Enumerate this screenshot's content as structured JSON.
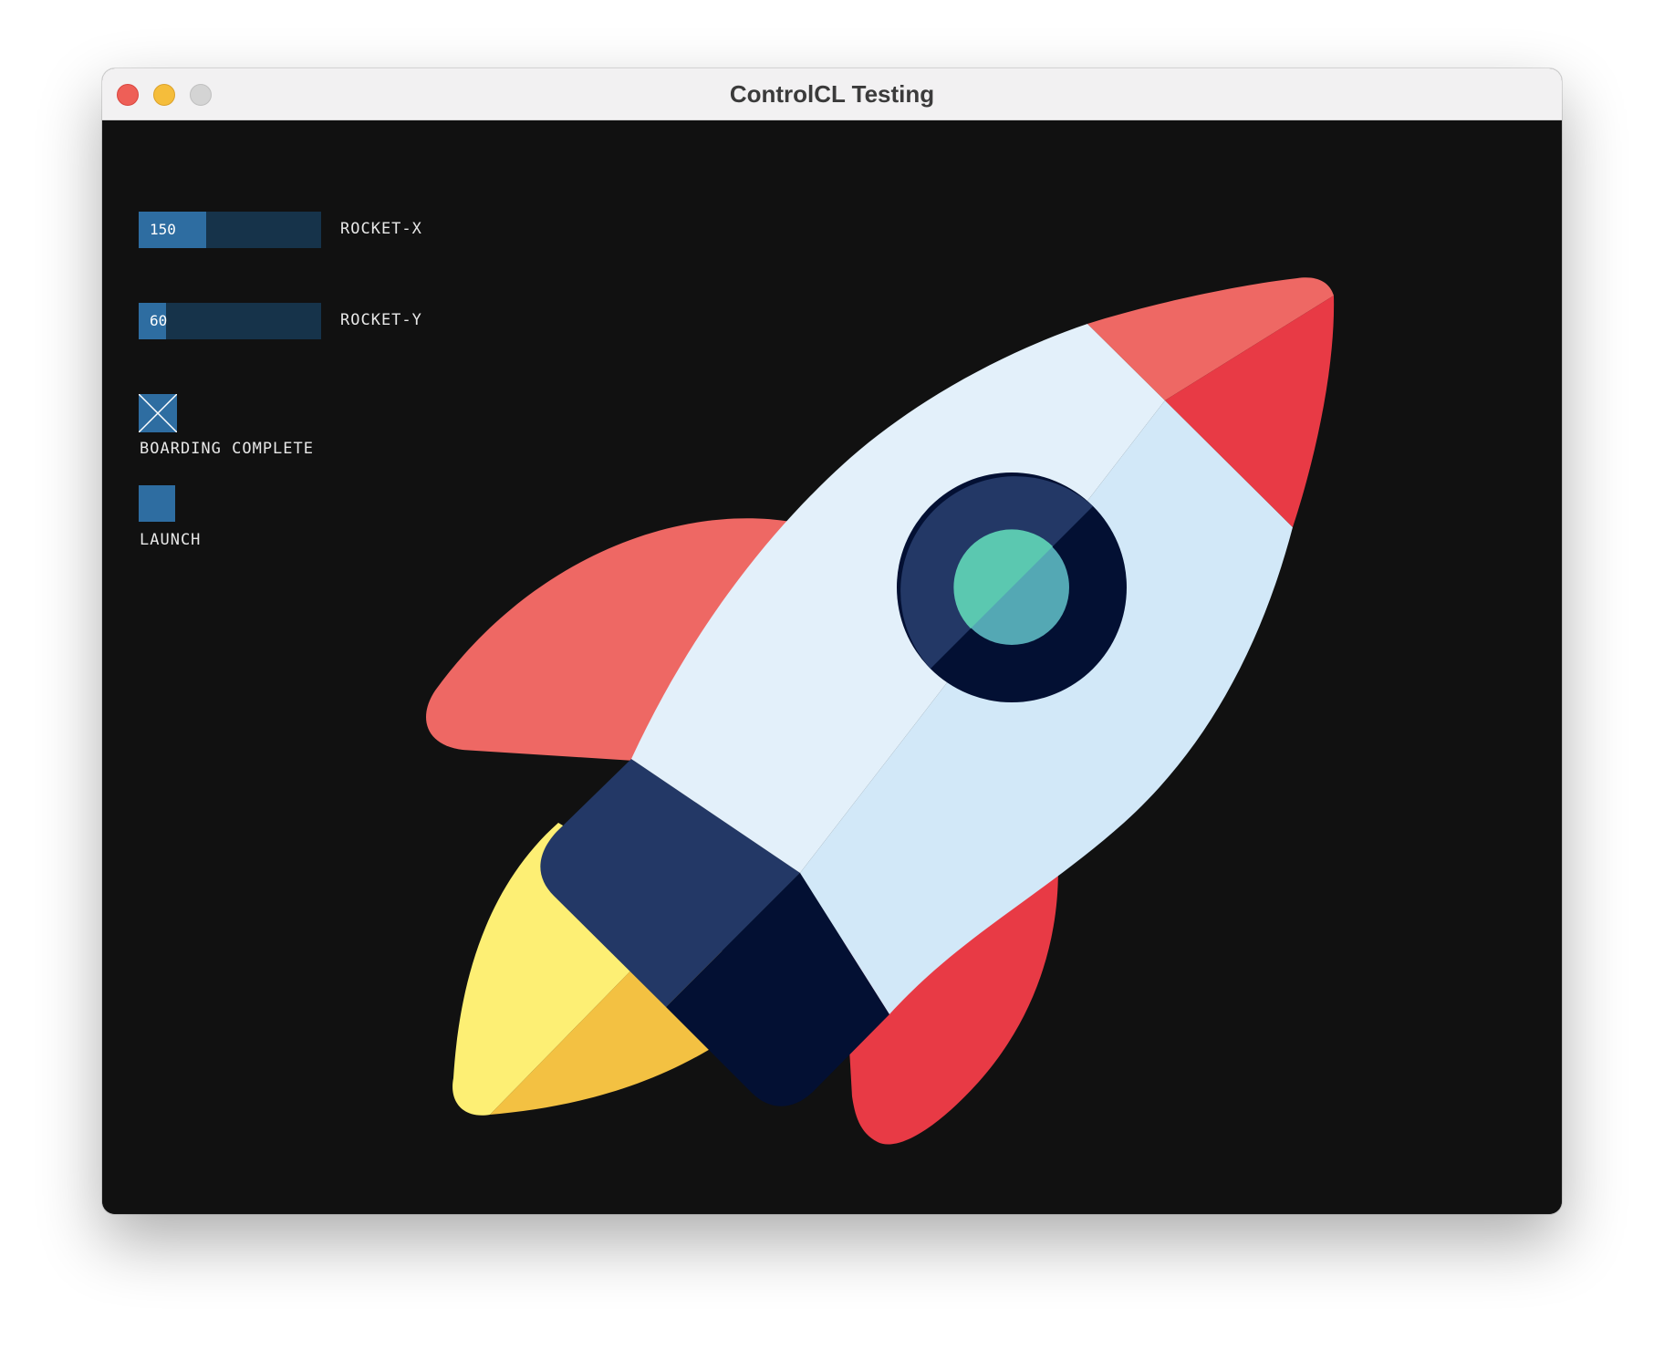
{
  "window": {
    "title": "ControlCL Testing"
  },
  "controls": {
    "rocket_x": {
      "label": "ROCKET-X",
      "value": "150",
      "fill_fraction": 0.37
    },
    "rocket_y": {
      "label": "ROCKET-Y",
      "value": "60",
      "fill_fraction": 0.15
    },
    "boarding": {
      "label": "BOARDING COMPLETE",
      "checked": true
    },
    "launch": {
      "label": "LAUNCH"
    }
  },
  "colors": {
    "canvas_bg": "#111111",
    "control_active": "#2e6da1",
    "control_track": "#16334a",
    "rocket_body_light": "#e3f0fa",
    "rocket_body_shade": "#d2e8f8",
    "rocket_fin_light": "#ee6864",
    "rocket_fin_dark": "#e83a45",
    "rocket_navy": "#233866",
    "rocket_navy_dark": "#031033",
    "window_glass": "#5bc8b0",
    "flame_light": "#fdef74",
    "flame_dark": "#f3c142"
  },
  "icons": {
    "rocket": "rocket-icon"
  }
}
